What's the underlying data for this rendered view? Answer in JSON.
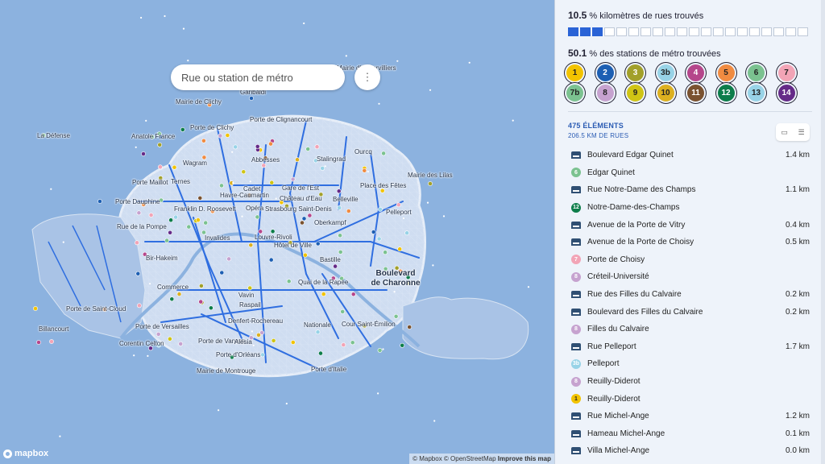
{
  "search": {
    "placeholder": "Rue ou station de métro"
  },
  "menu_icon": "⋮",
  "map_labels": [
    {
      "text": "Mairie d'Aubervilliers",
      "cls": ""
    },
    {
      "text": "Garibaldi",
      "cls": ""
    },
    {
      "text": "Mairie de Clichy",
      "cls": ""
    },
    {
      "text": "Porte de Clignancourt",
      "cls": ""
    },
    {
      "text": "Porte de Clichy",
      "cls": ""
    },
    {
      "text": "La Défense",
      "cls": ""
    },
    {
      "text": "Anatole France",
      "cls": ""
    },
    {
      "text": "Ourcq",
      "cls": ""
    },
    {
      "text": "Wagram",
      "cls": ""
    },
    {
      "text": "Abbesses",
      "cls": ""
    },
    {
      "text": "Stalingrad",
      "cls": ""
    },
    {
      "text": "Mairie des Lilas",
      "cls": ""
    },
    {
      "text": "Porte Maillot",
      "cls": ""
    },
    {
      "text": "Ternes",
      "cls": ""
    },
    {
      "text": "Cadet",
      "cls": ""
    },
    {
      "text": "Gare de l'Est",
      "cls": ""
    },
    {
      "text": "Place des Fêtes",
      "cls": ""
    },
    {
      "text": "Havre-Caumartin",
      "cls": ""
    },
    {
      "text": "Château d'Eau",
      "cls": ""
    },
    {
      "text": "Belleville",
      "cls": ""
    },
    {
      "text": "Porte Dauphine",
      "cls": ""
    },
    {
      "text": "Franklin D. Roosevelt",
      "cls": ""
    },
    {
      "text": "Opéra",
      "cls": ""
    },
    {
      "text": "Strasbourg Saint-Denis",
      "cls": ""
    },
    {
      "text": "Pelleport",
      "cls": ""
    },
    {
      "text": "Oberkampf",
      "cls": ""
    },
    {
      "text": "Rue de la Pompe",
      "cls": ""
    },
    {
      "text": "Invalides",
      "cls": ""
    },
    {
      "text": "Louvre-Rivoli",
      "cls": ""
    },
    {
      "text": "Hôtel de Ville",
      "cls": ""
    },
    {
      "text": "Bir-Hakeim",
      "cls": ""
    },
    {
      "text": "Bastille",
      "cls": ""
    },
    {
      "text": "Boulevard de Charonne",
      "cls": "big"
    },
    {
      "text": "Quai de la Rapée",
      "cls": ""
    },
    {
      "text": "Commerce",
      "cls": ""
    },
    {
      "text": "Vavin",
      "cls": ""
    },
    {
      "text": "Raspail",
      "cls": ""
    },
    {
      "text": "Porte de Saint-Cloud",
      "cls": ""
    },
    {
      "text": "Denfert-Rochereau",
      "cls": ""
    },
    {
      "text": "Nationale",
      "cls": ""
    },
    {
      "text": "Cour Saint-Émilion",
      "cls": ""
    },
    {
      "text": "Billancourt",
      "cls": ""
    },
    {
      "text": "Porte de Versailles",
      "cls": ""
    },
    {
      "text": "Corentin Celton",
      "cls": ""
    },
    {
      "text": "Porte de Vanves",
      "cls": ""
    },
    {
      "text": "Alésia",
      "cls": ""
    },
    {
      "text": "Porte d'Orléans",
      "cls": ""
    },
    {
      "text": "Mairie de Montrouge",
      "cls": ""
    },
    {
      "text": "Porte d'Italie",
      "cls": ""
    }
  ],
  "map_logo": "mapbox",
  "attribution": {
    "mapbox": "© Mapbox",
    "osm": "© OpenStreetMap",
    "improve": "Improve this map"
  },
  "stats": {
    "streets_value": "10.5",
    "streets_unit": "%",
    "streets_label": "kilomètres de rues trouvés",
    "streets_fraction": 0.105,
    "stations_value": "50.1",
    "stations_unit": "%",
    "stations_label": "des stations de métro trouvées"
  },
  "metro_lines": [
    {
      "label": "1",
      "color": "#f2c300",
      "text": "#222",
      "progress": 0.3
    },
    {
      "label": "2",
      "color": "#1d5fb3",
      "text": "#fff",
      "progress": 0.6
    },
    {
      "label": "3",
      "color": "#a2a02a",
      "text": "#fff",
      "progress": 0.5
    },
    {
      "label": "3b",
      "color": "#98d3e7",
      "text": "#222",
      "progress": 0.6
    },
    {
      "label": "4",
      "color": "#b5468b",
      "text": "#fff",
      "progress": 0.5
    },
    {
      "label": "5",
      "color": "#f08b41",
      "text": "#222",
      "progress": 0.4
    },
    {
      "label": "6",
      "color": "#7bc290",
      "text": "#222",
      "progress": 0.5
    },
    {
      "label": "7",
      "color": "#f2a4b6",
      "text": "#222",
      "progress": 0.3
    },
    {
      "label": "7b",
      "color": "#7bc290",
      "text": "#222",
      "progress": 0.5
    },
    {
      "label": "8",
      "color": "#c6a2cf",
      "text": "#222",
      "progress": 0.4
    },
    {
      "label": "9",
      "color": "#cfc414",
      "text": "#222",
      "progress": 0.5
    },
    {
      "label": "10",
      "color": "#dcb020",
      "text": "#222",
      "progress": 0.5
    },
    {
      "label": "11",
      "color": "#7a5230",
      "text": "#fff",
      "progress": 0.6
    },
    {
      "label": "12",
      "color": "#0d7d4a",
      "text": "#fff",
      "progress": 0.6
    },
    {
      "label": "13",
      "color": "#98d3e7",
      "text": "#222",
      "progress": 0.4
    },
    {
      "label": "14",
      "color": "#652b88",
      "text": "#fff",
      "progress": 0.6
    }
  ],
  "list_header": {
    "count": "475 ÉLÉMENTS",
    "km": "206.5 KM DE RUES"
  },
  "list_icons": {
    "calendar": "calendar-icon",
    "sort": "sort-icon"
  },
  "items": [
    {
      "type": "street",
      "name": "Boulevard Edgar Quinet",
      "dist": "1.4 km"
    },
    {
      "type": "station",
      "line": "6",
      "color": "#7bc290",
      "text": "#fff",
      "name": "Edgar Quinet",
      "dist": ""
    },
    {
      "type": "street",
      "name": "Rue Notre-Dame des Champs",
      "dist": "1.1 km"
    },
    {
      "type": "station",
      "line": "12",
      "color": "#0d7d4a",
      "text": "#fff",
      "name": "Notre-Dame-des-Champs",
      "dist": ""
    },
    {
      "type": "street",
      "name": "Avenue de la Porte de Vitry",
      "dist": "0.4 km"
    },
    {
      "type": "street",
      "name": "Avenue de la Porte de Choisy",
      "dist": "0.5 km"
    },
    {
      "type": "station",
      "line": "7",
      "color": "#f2a4b6",
      "text": "#fff",
      "name": "Porte de Choisy",
      "dist": ""
    },
    {
      "type": "station",
      "line": "8",
      "color": "#c6a2cf",
      "text": "#fff",
      "name": "Créteil-Université",
      "dist": ""
    },
    {
      "type": "street",
      "name": "Rue des Filles du Calvaire",
      "dist": "0.2 km"
    },
    {
      "type": "street",
      "name": "Boulevard des Filles du Calvaire",
      "dist": "0.2 km"
    },
    {
      "type": "station",
      "line": "8",
      "color": "#c6a2cf",
      "text": "#fff",
      "name": "Filles du Calvaire",
      "dist": ""
    },
    {
      "type": "street",
      "name": "Rue Pelleport",
      "dist": "1.7 km"
    },
    {
      "type": "station",
      "line": "3b",
      "color": "#98d3e7",
      "text": "#fff",
      "name": "Pelleport",
      "dist": ""
    },
    {
      "type": "station",
      "line": "8",
      "color": "#c6a2cf",
      "text": "#fff",
      "name": "Reuilly-Diderot",
      "dist": ""
    },
    {
      "type": "station",
      "line": "1",
      "color": "#f2c300",
      "text": "#222",
      "name": "Reuilly-Diderot",
      "dist": ""
    },
    {
      "type": "street",
      "name": "Rue Michel-Ange",
      "dist": "1.2 km"
    },
    {
      "type": "street",
      "name": "Hameau Michel-Ange",
      "dist": "0.1 km"
    },
    {
      "type": "street",
      "name": "Villa Michel-Ange",
      "dist": "0.0 km"
    }
  ]
}
